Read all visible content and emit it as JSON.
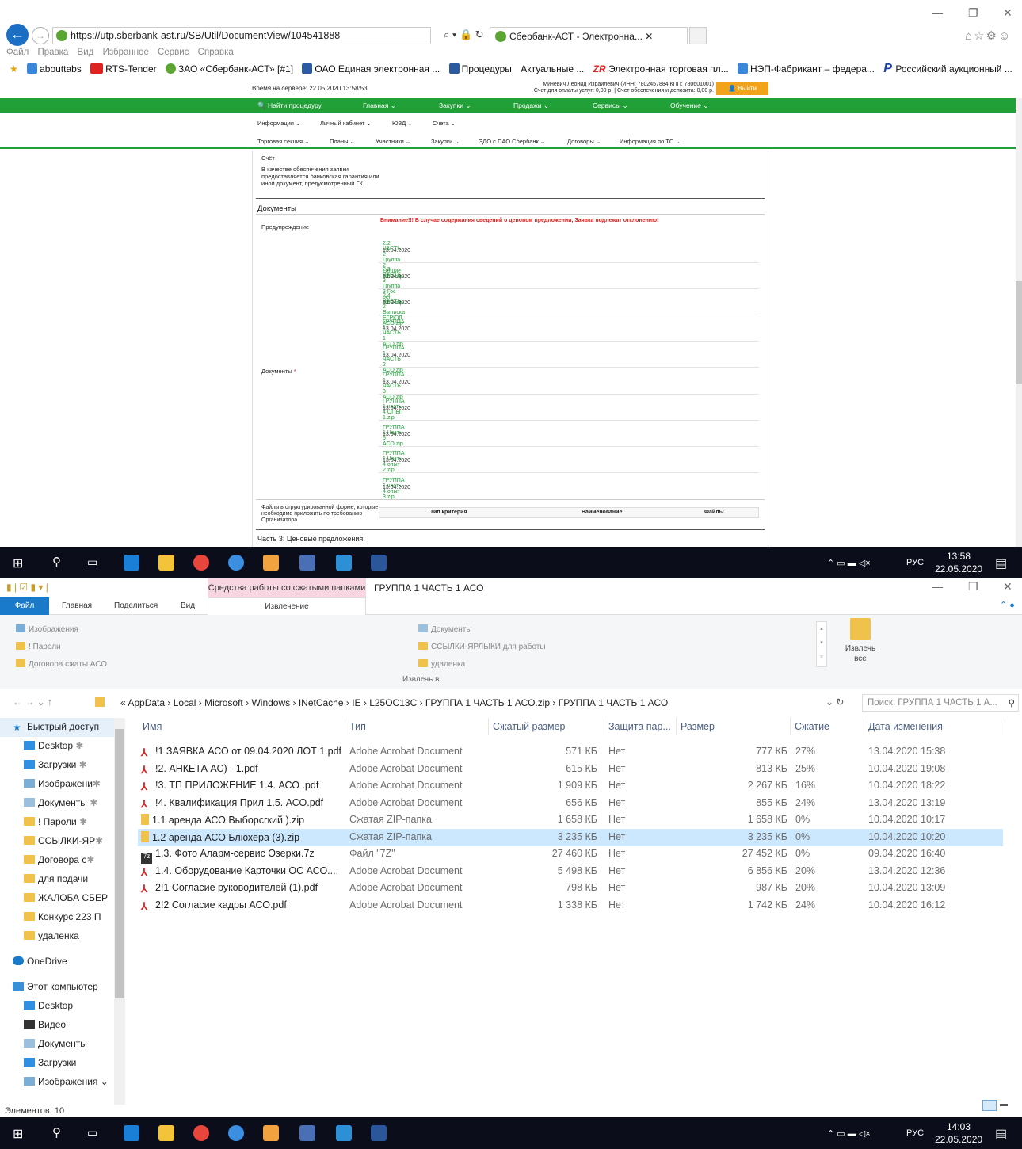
{
  "ie": {
    "url": "https://utp.sberbank-ast.ru/SB/Util/DocumentView/104541888",
    "tab_title": "Сбербанк-АСТ - Электронна...",
    "menu": [
      "Файл",
      "Правка",
      "Вид",
      "Избранное",
      "Сервис",
      "Справка"
    ],
    "favorites": [
      "abouttabs",
      "RTS-Tender",
      "ЗАО «Сбербанк-АСТ» [#1]",
      "ОАО Единая электронная ...",
      "Процедуры",
      "Актуальные ...",
      "Электронная торговая пл...",
      "НЭП-Фабрикант – федера...",
      "Российский аукционный ..."
    ],
    "server_time": "Время на сервере: 22.05.2020 13:58:53",
    "user_info_1": "Миневич Леонид Израилевич (ИНН: 7802457884 КПП: 780601001)",
    "user_info_2": "Счет для оплаты услуг: 0,00 р. | Счет обеспечения и депозита: 0,00 р.",
    "logout": "Выйти",
    "green_nav": [
      "Найти процедуру",
      "Главная",
      "Закупки",
      "Продажи",
      "Сервисы",
      "Обучение"
    ],
    "subnav1": [
      "Информация",
      "Личный кабинет",
      "ЮЗД",
      "Счета"
    ],
    "subnav2": [
      "Торговая секция",
      "Планы",
      "Участники",
      "Закупки",
      "ЭДО с ПАО Сбербанк",
      "Договоры",
      "Информация по ТС"
    ],
    "content": {
      "account_label": "Счёт",
      "guarantee_label": "В качестве обеспечения заявки предоставляется банковская гарантия или иной документ, предусмотренный ГК",
      "documents_header": "Документы",
      "warning_label": "Предупреждение",
      "warning_text": "Внимание!!! В случае содержания сведений о ценовом предложении, Заявка подлежат отклонению!",
      "documents_label": "Документы",
      "docs": [
        {
          "name": "2.2. ЧАСТЬ 2 Группа 2 Общие АСО.zip",
          "date": "13.04.2020"
        },
        {
          "name": "2.3. ЧАСТЬ 3 Группа 3 Гос рег АСО.zip",
          "date": "13.04.2020"
        },
        {
          "name": "2.4. ЧАСТЬ 2 Выписка ЕГРЮЛ АСО.zip",
          "date": "13.04.2020"
        },
        {
          "name": "ГРУППА 1 ЧАСТЬ 1 АСО.zip",
          "date": "13.04.2020"
        },
        {
          "name": "ГРУППА 1 ЧАСТЬ 2 АСО.zip",
          "date": "13.04.2020"
        },
        {
          "name": "ГРУППА 1 ЧАСТЬ 3 АСО.zip",
          "date": "13.04.2020"
        },
        {
          "name": "ГРУППА 1 часть 4 ОПЫТ 1.zip",
          "date": "13.04.2020"
        },
        {
          "name": "ГРУППА 1 Часть 5 АСО.zip",
          "date": "13.04.2020"
        },
        {
          "name": "ГРУППА 1 Часть 4 опыт 2.zip",
          "date": "13.04.2020"
        },
        {
          "name": "ГРУППА 1 часть 4 опыт 3.zip",
          "date": "13.04.2020"
        }
      ],
      "structured_label": "Файлы в структурированной форме, которые необходимо приложить по требованию Организатора",
      "col_type": "Тип критерия",
      "col_name": "Наименование",
      "col_files": "Файлы",
      "part3": "Часть 3: Ценовые предложения."
    }
  },
  "taskbar_top": {
    "lang": "РУС",
    "time": "13:58",
    "date": "22.05.2020"
  },
  "taskbar_bottom": {
    "lang": "РУС",
    "time": "14:03",
    "date": "22.05.2020"
  },
  "explorer": {
    "context_tab": "Средства работы со сжатыми папками",
    "window_title": "ГРУППА 1 ЧАСТЬ 1 АСО",
    "tabs": {
      "file": "Файл",
      "home": "Главная",
      "share": "Поделиться",
      "view": "Вид",
      "extract": "Извлечение"
    },
    "extract_to": [
      "Изображения",
      "! Пароли",
      "Договора сжаты АСО",
      "Документы",
      "ССЫЛКИ-ЯРЛЫКИ для работы",
      "удаленка"
    ],
    "extract_to_label": "Извлечь в",
    "extract_all": "Извлечь все",
    "breadcrumb": [
      "AppData",
      "Local",
      "Microsoft",
      "Windows",
      "INetCache",
      "IE",
      "L25OC13C",
      "ГРУППА 1 ЧАСТЬ 1 АСО.zip",
      "ГРУППА 1 ЧАСТЬ 1 АСО"
    ],
    "search_placeholder": "Поиск: ГРУППА 1 ЧАСТЬ 1 А...",
    "nav": [
      "Быстрый доступ",
      "Desktop",
      "Загрузки",
      "Изображени",
      "Документы",
      "! Пароли",
      "ССЫЛКИ-ЯР",
      "Договора с",
      "для подачи",
      "ЖАЛОБА СБЕР",
      "Конкурс 223 П",
      "удаленка",
      "OneDrive",
      "Этот компьютер",
      "Desktop",
      "Видео",
      "Документы",
      "Загрузки",
      "Изображения"
    ],
    "columns": [
      "Имя",
      "Тип",
      "Сжатый размер",
      "Защита пар...",
      "Размер",
      "Сжатие",
      "Дата изменения"
    ],
    "files": [
      {
        "name": "!1 ЗАЯВКА АСО от 09.04.2020 ЛОТ 1.pdf",
        "type": "Adobe Acrobat Document",
        "csize": "571 КБ",
        "prot": "Нет",
        "size": "777 КБ",
        "pct": "27%",
        "date": "13.04.2020 15:38",
        "icon": "pdf-icon"
      },
      {
        "name": "!2. АНКЕТА АС) - 1.pdf",
        "type": "Adobe Acrobat Document",
        "csize": "615 КБ",
        "prot": "Нет",
        "size": "813 КБ",
        "pct": "25%",
        "date": "10.04.2020 19:08",
        "icon": "pdf-icon"
      },
      {
        "name": "!3. ТП ПРИЛОЖЕНИЕ 1.4. АСО .pdf",
        "type": "Adobe Acrobat Document",
        "csize": "1 909 КБ",
        "prot": "Нет",
        "size": "2 267 КБ",
        "pct": "16%",
        "date": "10.04.2020 18:22",
        "icon": "pdf-icon"
      },
      {
        "name": "!4. Квалификация Прил 1.5. АСО.pdf",
        "type": "Adobe Acrobat Document",
        "csize": "656 КБ",
        "prot": "Нет",
        "size": "855 КБ",
        "pct": "24%",
        "date": "13.04.2020 13:19",
        "icon": "pdf-icon"
      },
      {
        "name": "1.1 аренда АСО Выборсгкий ).zip",
        "type": "Сжатая ZIP-папка",
        "csize": "1 658 КБ",
        "prot": "Нет",
        "size": "1 658 КБ",
        "pct": "0%",
        "date": "10.04.2020 10:17",
        "icon": "zip-icon"
      },
      {
        "name": "1.2 аренда АСО Блюхера (3).zip",
        "type": "Сжатая ZIP-папка",
        "csize": "3 235 КБ",
        "prot": "Нет",
        "size": "3 235 КБ",
        "pct": "0%",
        "date": "10.04.2020 10:20",
        "icon": "zip-icon"
      },
      {
        "name": "1.3. Фото Аларм-сервис Озерки.7z",
        "type": "Файл \"7Z\"",
        "csize": "27 460 КБ",
        "prot": "Нет",
        "size": "27 452 КБ",
        "pct": "0%",
        "date": "09.04.2020 16:40",
        "icon": "7z-icon"
      },
      {
        "name": "1.4. Оборудование Карточки ОС АСО....",
        "type": "Adobe Acrobat Document",
        "csize": "5 498 КБ",
        "prot": "Нет",
        "size": "6 856 КБ",
        "pct": "20%",
        "date": "13.04.2020 12:36",
        "icon": "pdf-icon"
      },
      {
        "name": "2!1 Согласие руководителей (1).pdf",
        "type": "Adobe Acrobat Document",
        "csize": "798 КБ",
        "prot": "Нет",
        "size": "987 КБ",
        "pct": "20%",
        "date": "10.04.2020 13:09",
        "icon": "pdf-icon"
      },
      {
        "name": "2!2 Согласие кадры АСО.pdf",
        "type": "Adobe Acrobat Document",
        "csize": "1 338 КБ",
        "prot": "Нет",
        "size": "1 742 КБ",
        "pct": "24%",
        "date": "10.04.2020 16:12",
        "icon": "pdf-icon"
      }
    ],
    "selected_index": 5,
    "status": "Элементов: 10"
  },
  "colors": {
    "green": "#21a038",
    "blue": "#1979ca",
    "selection": "#cce8ff"
  }
}
